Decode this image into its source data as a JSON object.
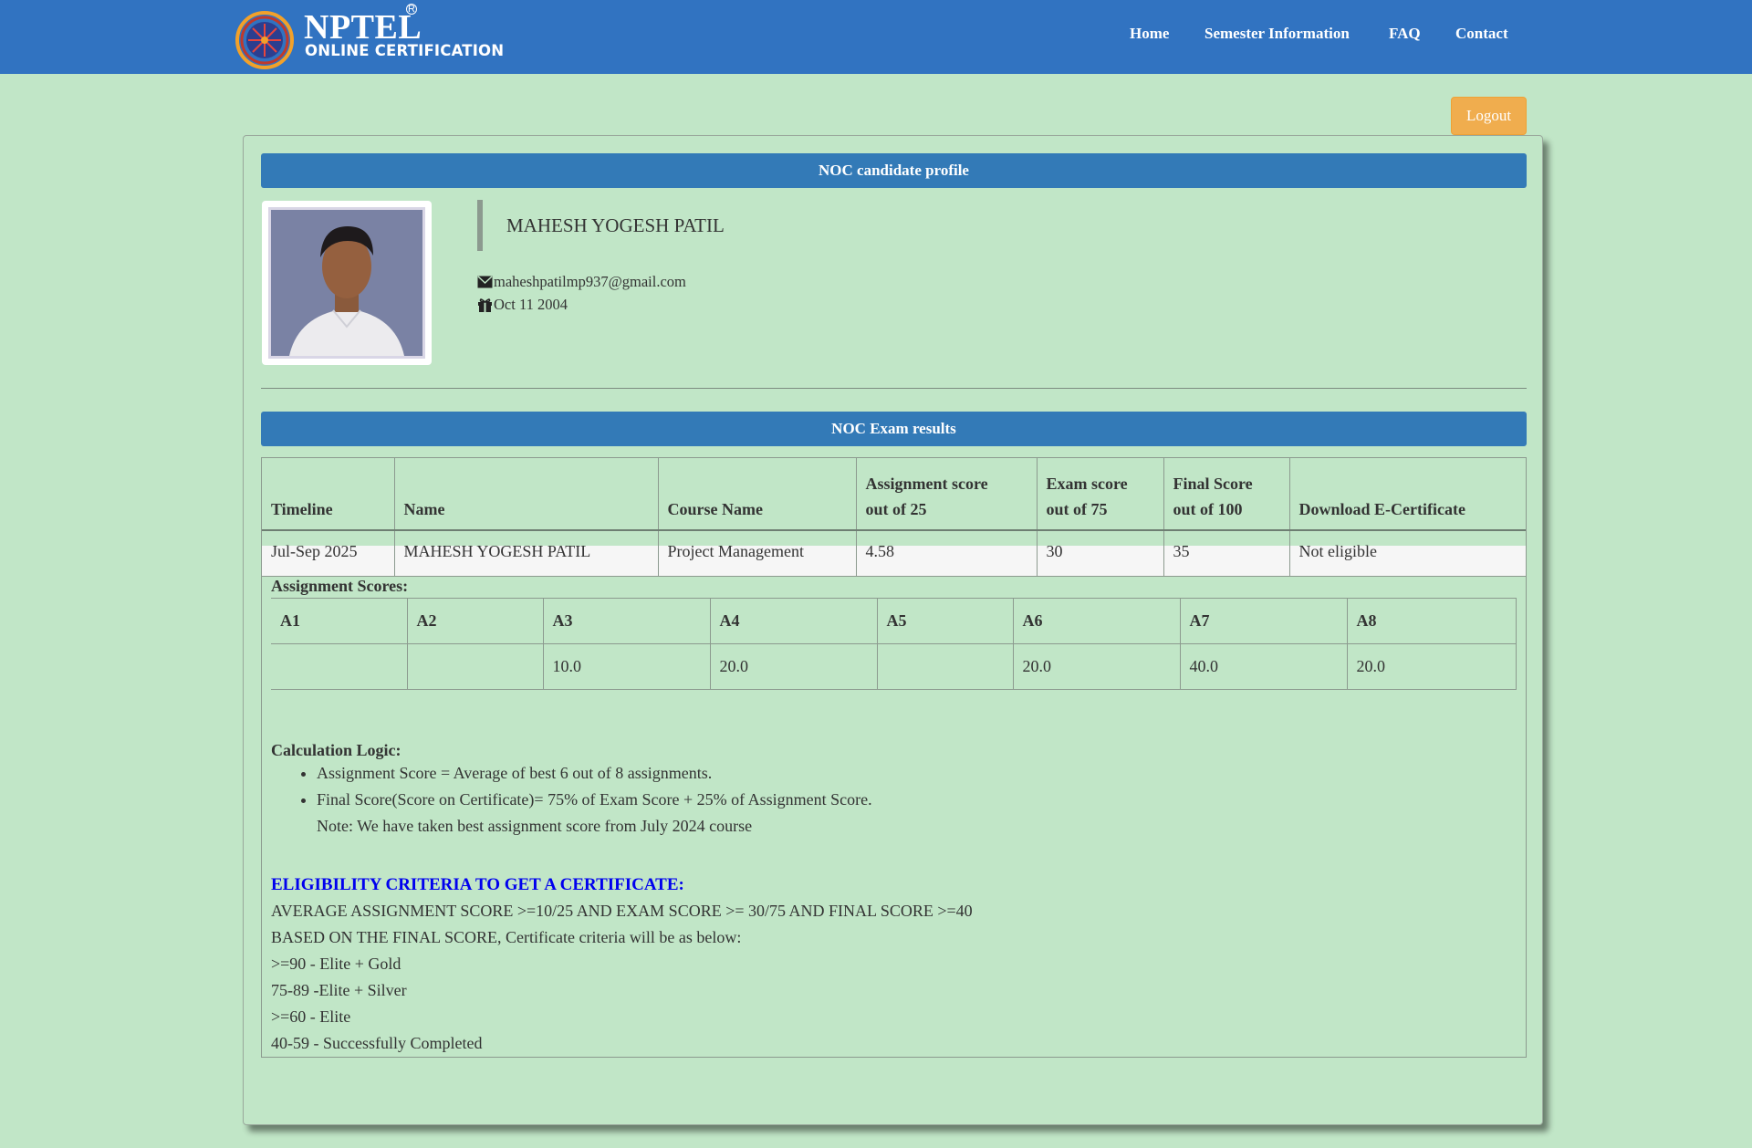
{
  "header": {
    "logo_title": "NPTEL",
    "logo_reg": "R",
    "logo_subtitle": "ONLINE CERTIFICATION",
    "nav": [
      "Home",
      "Semester Information",
      "FAQ",
      "Contact"
    ]
  },
  "logout_label": "Logout",
  "profile": {
    "section_title": "NOC candidate profile",
    "name": "MAHESH YOGESH PATIL",
    "email": "maheshpatilmp937@gmail.com",
    "dob": "Oct 11 2004",
    "icons": {
      "email": "envelope-icon",
      "dob": "gift-icon"
    }
  },
  "results": {
    "section_title": "NOC Exam results",
    "headers": {
      "timeline": "Timeline",
      "name": "Name",
      "course": "Course Name",
      "assignment_l1": "Assignment score",
      "assignment_l2": "out of 25",
      "exam_l1": "Exam score",
      "exam_l2": "out of 75",
      "final_l1": "Final Score",
      "final_l2": "out of 100",
      "download": "Download E-Certificate"
    },
    "row": {
      "timeline": "Jul-Sep 2025",
      "name": "MAHESH YOGESH PATIL",
      "course": "Project Management",
      "assignment": "4.58",
      "exam": "30",
      "final": "35",
      "download": "Not eligible"
    },
    "assignment_scores_title": "Assignment Scores:",
    "assignments": [
      {
        "label": "A1",
        "score": ""
      },
      {
        "label": "A2",
        "score": ""
      },
      {
        "label": "A3",
        "score": "10.0"
      },
      {
        "label": "A4",
        "score": "20.0"
      },
      {
        "label": "A5",
        "score": ""
      },
      {
        "label": "A6",
        "score": "20.0"
      },
      {
        "label": "A7",
        "score": "40.0"
      },
      {
        "label": "A8",
        "score": "20.0"
      }
    ],
    "calc_title": "Calculation Logic:",
    "calc_items": [
      "Assignment Score = Average of best 6 out of 8 assignments.",
      "Final Score(Score on Certificate)= 75% of Exam Score + 25% of Assignment Score."
    ],
    "calc_note": "Note: We have taken best assignment score from July 2024 course",
    "eligibility_title": "ELIGIBILITY CRITERIA TO GET A CERTIFICATE:",
    "eligibility_lines": [
      "AVERAGE ASSIGNMENT SCORE >=10/25 AND EXAM SCORE >= 30/75 AND FINAL SCORE >=40",
      "BASED ON THE FINAL SCORE, Certificate criteria will be as below:",
      ">=90 - Elite + Gold",
      "75-89 -Elite + Silver",
      ">=60 - Elite",
      "40-59 - Successfully Completed"
    ]
  },
  "colors": {
    "navbar": "#3173c1",
    "background": "#c1e6c7",
    "section_bar": "#337ab7",
    "logout": "#f0ad4e",
    "eligibility_title": "#0000ee"
  }
}
